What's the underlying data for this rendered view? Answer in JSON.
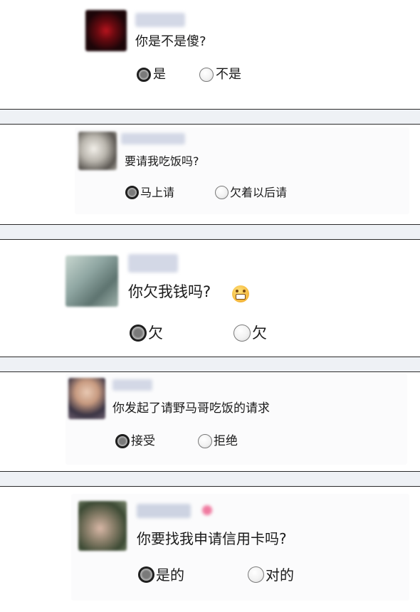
{
  "polls": [
    {
      "question": "你是不是傻?",
      "options": [
        {
          "label": "是",
          "selected": true
        },
        {
          "label": "不是",
          "selected": false
        }
      ],
      "avatar_color": "#5a0d12"
    },
    {
      "question": "要请我吃饭吗?",
      "options": [
        {
          "label": "马上请",
          "selected": true
        },
        {
          "label": "欠着以后请",
          "selected": false
        }
      ],
      "avatar_color": "#b9b5ad"
    },
    {
      "question": "你欠我钱吗?",
      "options": [
        {
          "label": "欠",
          "selected": true
        },
        {
          "label": "欠",
          "selected": false
        }
      ],
      "avatar_color": "#8fa6a2",
      "emoji": "grimacing-face-icon"
    },
    {
      "question": "你发起了请野马哥吃饭的请求",
      "options": [
        {
          "label": "接受",
          "selected": true
        },
        {
          "label": "拒绝",
          "selected": false
        }
      ],
      "avatar_color": "#a27f73"
    },
    {
      "question": "你要找我申请信用卡吗?",
      "options": [
        {
          "label": "是的",
          "selected": true
        },
        {
          "label": "对的",
          "selected": false
        }
      ],
      "avatar_color": "#6e7a62",
      "emoji": "heart-icon"
    }
  ],
  "colors": {
    "separator": "#eef1f5",
    "text": "#1a1a1a",
    "name_blur": "#cdd3e2"
  }
}
